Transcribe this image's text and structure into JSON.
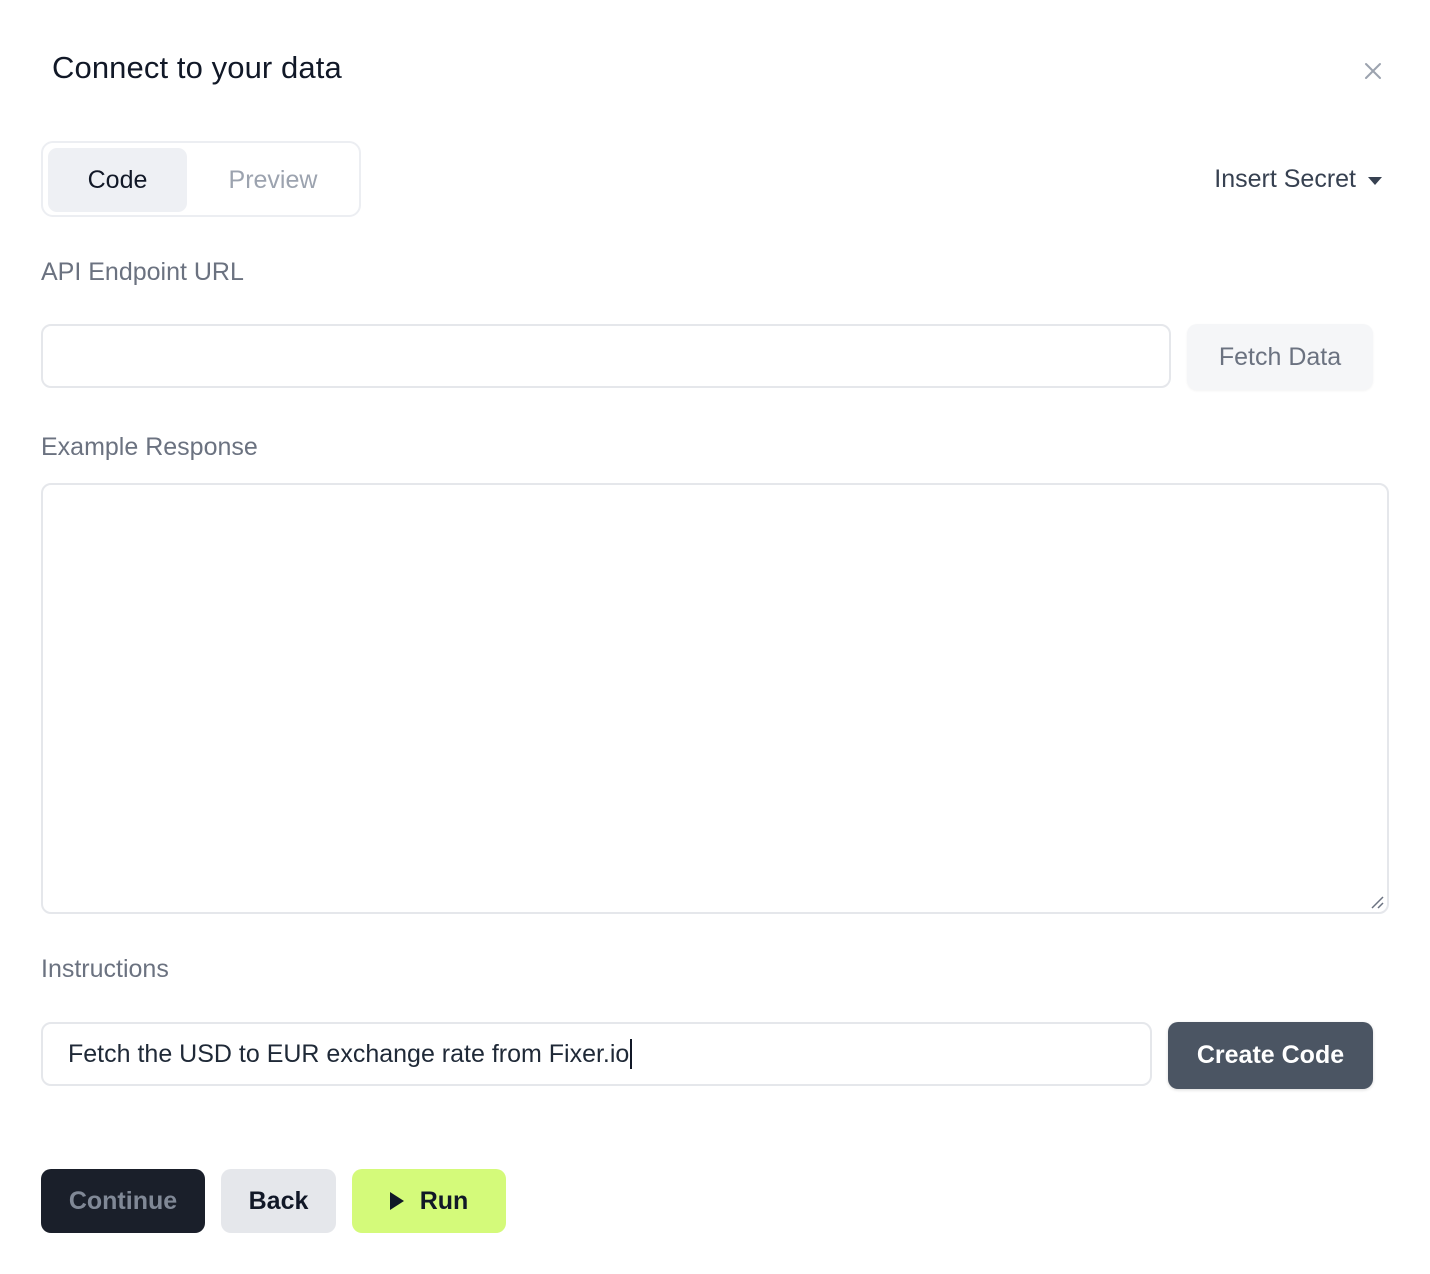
{
  "dialog": {
    "title": "Connect to your data",
    "close_icon": "close-icon"
  },
  "tabs": [
    {
      "label": "Code",
      "active": true
    },
    {
      "label": "Preview",
      "active": false
    }
  ],
  "insert_secret": {
    "label": "Insert Secret",
    "icon": "caret-down-icon"
  },
  "api_endpoint": {
    "label": "API Endpoint URL",
    "value": "",
    "placeholder": "",
    "fetch_button": "Fetch Data"
  },
  "example_response": {
    "label": "Example Response",
    "value": ""
  },
  "instructions": {
    "label": "Instructions",
    "value": "Fetch the USD to EUR exchange rate from Fixer.io",
    "create_button": "Create Code"
  },
  "footer": {
    "continue_label": "Continue",
    "back_label": "Back",
    "run_label": "Run",
    "run_icon": "play-icon"
  },
  "colors": {
    "primary_dark": "#1a1f2a",
    "create_button_bg": "#4b5563",
    "run_button_bg": "#d4fa7a",
    "muted_text": "#6b7280",
    "border": "#e5e7eb"
  }
}
